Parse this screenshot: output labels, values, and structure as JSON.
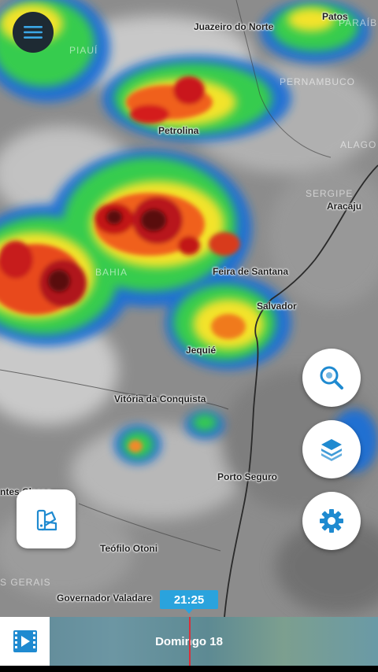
{
  "map": {
    "cities": [
      {
        "id": "patos",
        "label": "Patos"
      },
      {
        "id": "juazeiro",
        "label": "Juazeiro do Norte"
      },
      {
        "id": "petrolina",
        "label": "Petrolina"
      },
      {
        "id": "aracaju",
        "label": "Aracaju"
      },
      {
        "id": "feira",
        "label": "Feira de Santana"
      },
      {
        "id": "salvador",
        "label": "Salvador"
      },
      {
        "id": "jequie",
        "label": "Jequié"
      },
      {
        "id": "vitoria",
        "label": "Vitória da Conquista"
      },
      {
        "id": "portoseguro",
        "label": "Porto Seguro"
      },
      {
        "id": "montesclaros",
        "label": "ntes Claros"
      },
      {
        "id": "teofilo",
        "label": "Teófilo Otoni"
      },
      {
        "id": "valadares",
        "label": "Governador Valadare"
      }
    ],
    "states": [
      {
        "id": "piaui",
        "label": "PIAUÍ"
      },
      {
        "id": "paraiba",
        "label": "PARAÍB"
      },
      {
        "id": "pernambuco",
        "label": "PERNAMBUCO"
      },
      {
        "id": "alagoas",
        "label": "ALAGO"
      },
      {
        "id": "sergipe",
        "label": "SERGIPE"
      },
      {
        "id": "bahia",
        "label": "BAHIA"
      },
      {
        "id": "gerais",
        "label": "S GERAIS"
      }
    ]
  },
  "controls": {
    "menu_icon": "hamburger-icon",
    "zoom_icon": "magnifier-icon",
    "layers_icon": "layers-icon",
    "settings_icon": "gear-icon",
    "legend_icon": "color-swatch-icon"
  },
  "timeline": {
    "time": "21:25",
    "day": "Domingo 18",
    "play_icon": "video-play-icon"
  },
  "colors": {
    "accent": "#2aa3dd",
    "playhead": "#d9303a",
    "icon_blue": "#1f8ad0",
    "menu_bg": "#1e2a33"
  }
}
